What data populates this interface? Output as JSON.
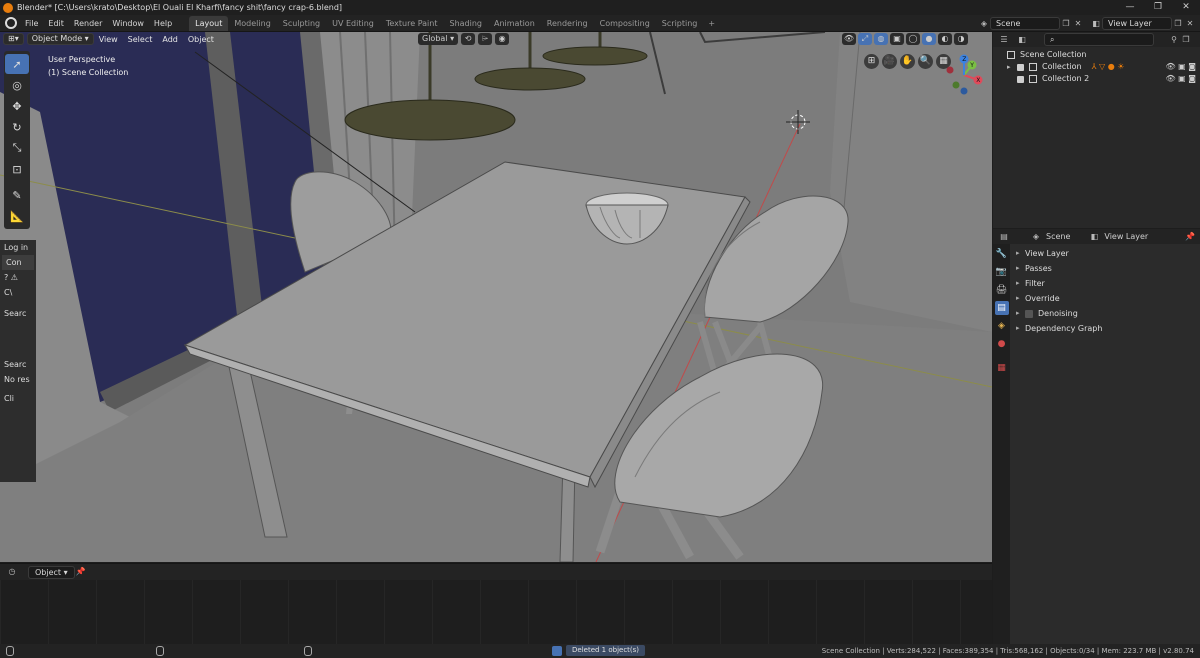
{
  "window": {
    "title": "Blender* [C:\\Users\\krato\\Desktop\\El Ouali El Kharfi\\fancy shit\\fancy crap-6.blend]",
    "controls": [
      "—",
      "❐",
      "✕"
    ]
  },
  "menus": [
    "File",
    "Edit",
    "Render",
    "Window",
    "Help"
  ],
  "workspaces": [
    "Layout",
    "Modeling",
    "Sculpting",
    "UV Editing",
    "Texture Paint",
    "Shading",
    "Animation",
    "Rendering",
    "Compositing",
    "Scripting"
  ],
  "workspace_add": "+",
  "scene_field": "Scene",
  "view_layer_field": "View Layer",
  "viewport": {
    "mode": "Object Mode",
    "menus": [
      "View",
      "Select",
      "Add",
      "Object"
    ],
    "orientation": "Global",
    "info_line1": "User Perspective",
    "info_line2": "(1) Scene Collection",
    "gizmo_axes": [
      "X",
      "Y",
      "Z"
    ]
  },
  "npanel": {
    "rows": [
      "Log in",
      "Con",
      "?",
      "C\\",
      "Searc",
      "Searc",
      "No res",
      "Cli"
    ]
  },
  "timeline": {
    "mode": "Object"
  },
  "outliner": {
    "search_placeholder": "",
    "root": "Scene Collection",
    "collections": [
      "Collection",
      "Collection 2"
    ]
  },
  "properties": {
    "tab_scene": "Scene",
    "tab_view_layer": "View Layer",
    "sections": [
      "View Layer",
      "Passes",
      "Filter",
      "Override",
      "Denoising",
      "Dependency Graph"
    ]
  },
  "statusbar": {
    "report": "Deleted 1 object(s)",
    "stats": "Scene Collection | Verts:284,522 | Faces:389,354 | Tris:568,162 | Objects:0/34 | Mem: 223.7 MB | v2.80.74"
  },
  "colors": {
    "accent": "#4772b3",
    "viewport_bg": "#7b7b7b",
    "window_glass": "#2a2c55",
    "lamp_shade": "#4a4932",
    "orange": "#e87d0d"
  }
}
